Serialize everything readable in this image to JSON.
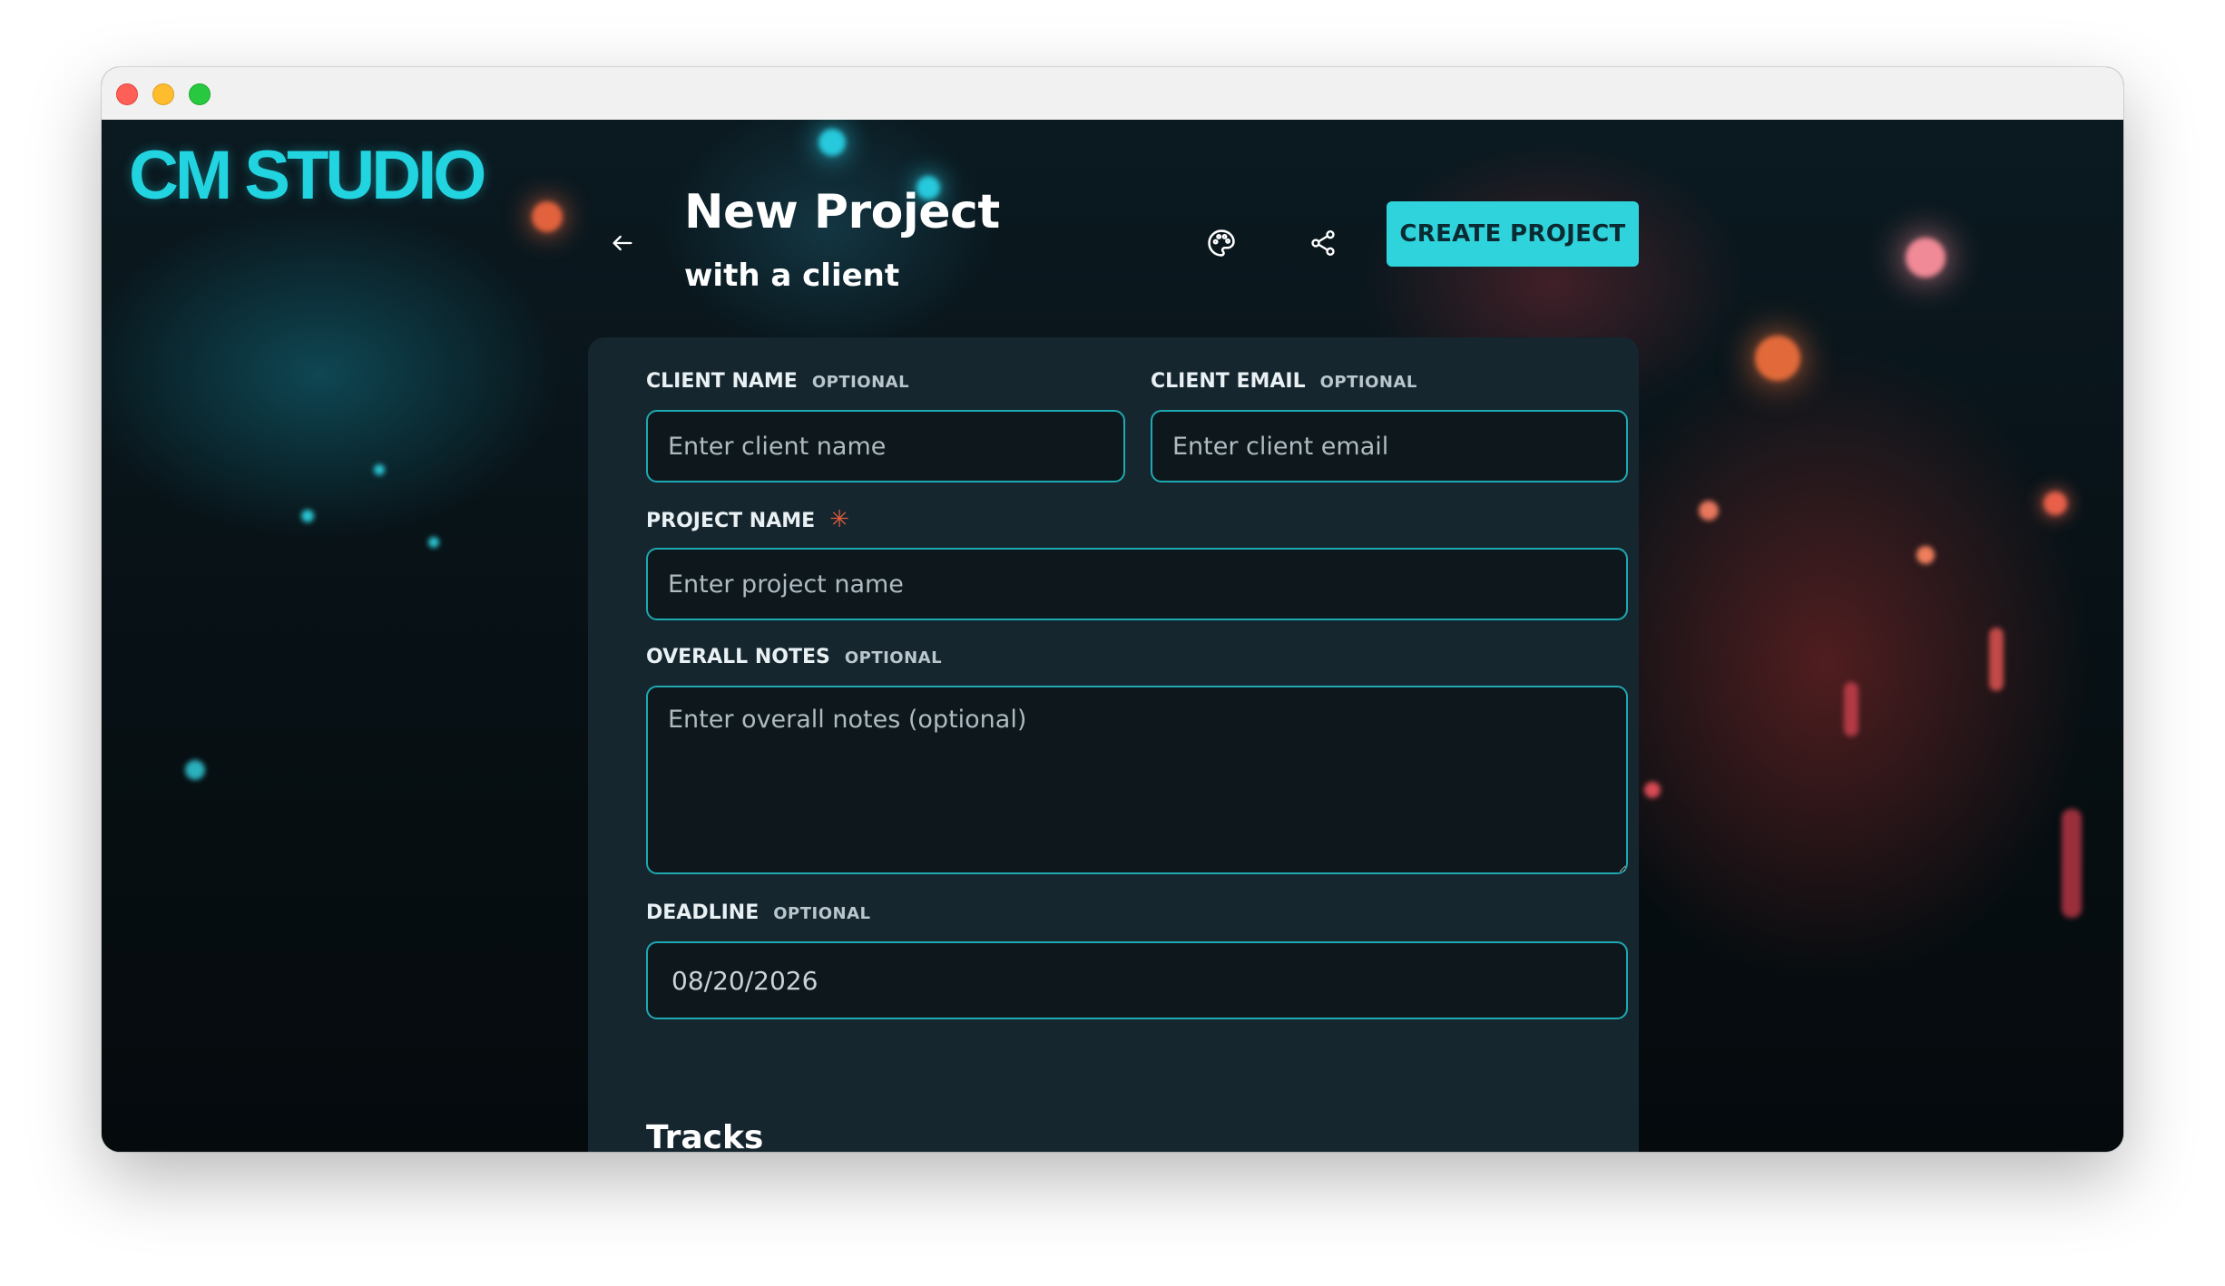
{
  "window": {
    "controls": [
      "close",
      "minimize",
      "maximize"
    ]
  },
  "brand": {
    "logo_text": "CM STUDIO",
    "accent_color": "#2ed3dc"
  },
  "header": {
    "back_icon": "arrow-left-icon",
    "title": "New Project",
    "subtitle": "with a client",
    "palette_icon": "palette-icon",
    "share_icon": "share-icon",
    "create_label": "CREATE PROJECT"
  },
  "form": {
    "client_name": {
      "label": "CLIENT NAME",
      "tag": "OPTIONAL",
      "placeholder": "Enter client name",
      "value": ""
    },
    "client_email": {
      "label": "CLIENT EMAIL",
      "tag": "OPTIONAL",
      "placeholder": "Enter client email",
      "value": ""
    },
    "project_name": {
      "label": "PROJECT NAME",
      "required_marker": "✳",
      "placeholder": "Enter project name",
      "value": ""
    },
    "overall_notes": {
      "label": "OVERALL NOTES",
      "tag": "OPTIONAL",
      "placeholder": "Enter overall notes (optional)",
      "value": ""
    },
    "deadline": {
      "label": "DEADLINE",
      "tag": "OPTIONAL",
      "value": "08/20/2026"
    }
  },
  "tracks": {
    "title": "Tracks"
  }
}
